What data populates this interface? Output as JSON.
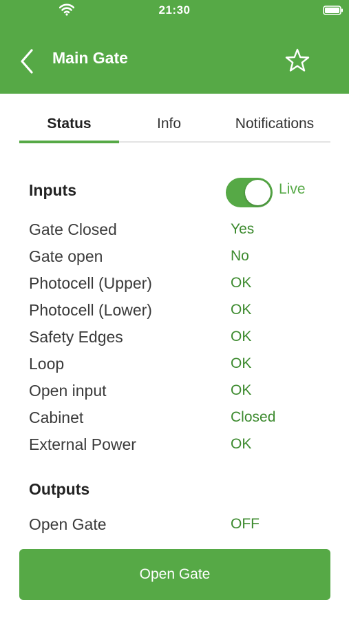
{
  "status_bar": {
    "time": "21:30"
  },
  "header": {
    "title": "Main Gate"
  },
  "tabs": [
    {
      "label": "Status"
    },
    {
      "label": "Info"
    },
    {
      "label": "Notifications"
    }
  ],
  "inputs": {
    "title": "Inputs",
    "live_label": "Live",
    "live_enabled": true,
    "rows": [
      {
        "label": "Gate Closed",
        "value": "Yes"
      },
      {
        "label": "Gate open",
        "value": "No"
      },
      {
        "label": "Photocell (Upper)",
        "value": "OK"
      },
      {
        "label": "Photocell (Lower)",
        "value": "OK"
      },
      {
        "label": "Safety Edges",
        "value": "OK"
      },
      {
        "label": "Loop",
        "value": "OK"
      },
      {
        "label": "Open input",
        "value": "OK"
      },
      {
        "label": "Cabinet",
        "value": "Closed"
      },
      {
        "label": "External Power",
        "value": "OK"
      }
    ]
  },
  "outputs": {
    "title": "Outputs",
    "rows": [
      {
        "label": "Open Gate",
        "value": "OFF"
      }
    ]
  },
  "action": {
    "open_gate_label": "Open Gate"
  },
  "colors": {
    "brand_green": "#56a946",
    "value_green": "#3c8a2e"
  }
}
